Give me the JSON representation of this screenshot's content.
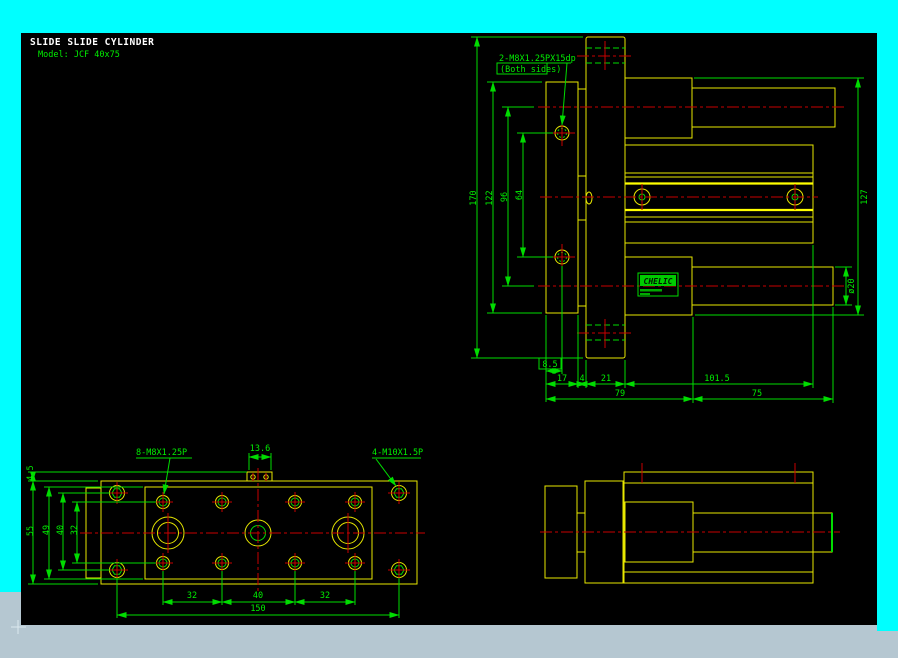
{
  "header": {
    "title": "SLIDE SLIDE CYLINDER",
    "model": "Model: JCF 40x75"
  },
  "colors": {
    "frame_cyan": "#00ffff",
    "frame_gray": "#b5c7d1",
    "canvas": "#000000",
    "geometry_yellow": "#e8e800",
    "dimension_green": "#00dc00",
    "centerline_red": "#c80000"
  },
  "logo": {
    "brand": "CHELIC"
  },
  "front_view": {
    "label_thread": "2-M8X1.25PX15dp",
    "label_thread_note": "(Both sides)",
    "dim_170": "170",
    "dim_122": "122",
    "dim_96": "96",
    "dim_64": "64",
    "dim_127": "127",
    "dim_rod_dia": "ø20",
    "dim_8_5": "8.5",
    "dim_17": "17",
    "dim_4": "4",
    "dim_21": "21",
    "dim_101_5": "101.5",
    "dim_79": "79",
    "dim_75": "75"
  },
  "top_view": {
    "label_m8": "8-M8X1.25P",
    "label_m10": "4-M10X1.5P",
    "dim_13_6": "13.6",
    "dim_4_5": "4.5",
    "dim_55": "55",
    "dim_49": "49",
    "dim_40": "40",
    "dim_32": "32",
    "dim_b32a": "32",
    "dim_b40": "40",
    "dim_b32b": "32",
    "dim_150": "150"
  }
}
